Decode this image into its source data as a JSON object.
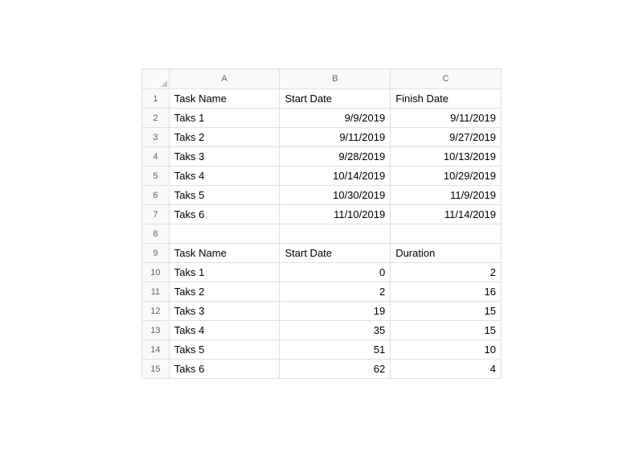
{
  "columns": [
    "A",
    "B",
    "C"
  ],
  "rowCount": 15,
  "rows": [
    {
      "n": "1",
      "A": "Task Name",
      "B": "Start Date",
      "C": "Finish Date",
      "header": true
    },
    {
      "n": "2",
      "A": "Taks 1",
      "B": "9/9/2019",
      "C": "9/11/2019"
    },
    {
      "n": "3",
      "A": "Taks 2",
      "B": "9/11/2019",
      "C": "9/27/2019"
    },
    {
      "n": "4",
      "A": "Taks 3",
      "B": "9/28/2019",
      "C": "10/13/2019"
    },
    {
      "n": "5",
      "A": "Taks 4",
      "B": "10/14/2019",
      "C": "10/29/2019"
    },
    {
      "n": "6",
      "A": "Taks 5",
      "B": "10/30/2019",
      "C": "11/9/2019"
    },
    {
      "n": "7",
      "A": "Taks 6",
      "B": "11/10/2019",
      "C": "11/14/2019"
    },
    {
      "n": "8",
      "A": "",
      "B": "",
      "C": ""
    },
    {
      "n": "9",
      "A": "Task Name",
      "B": "Start Date",
      "C": "Duration",
      "header": true
    },
    {
      "n": "10",
      "A": "Taks 1",
      "B": "0",
      "C": "2"
    },
    {
      "n": "11",
      "A": "Taks 2",
      "B": "2",
      "C": "16"
    },
    {
      "n": "12",
      "A": "Taks 3",
      "B": "19",
      "C": "15"
    },
    {
      "n": "13",
      "A": "Taks 4",
      "B": "35",
      "C": "15"
    },
    {
      "n": "14",
      "A": "Taks 5",
      "B": "51",
      "C": "10"
    },
    {
      "n": "15",
      "A": "Taks 6",
      "B": "62",
      "C": "4"
    }
  ]
}
